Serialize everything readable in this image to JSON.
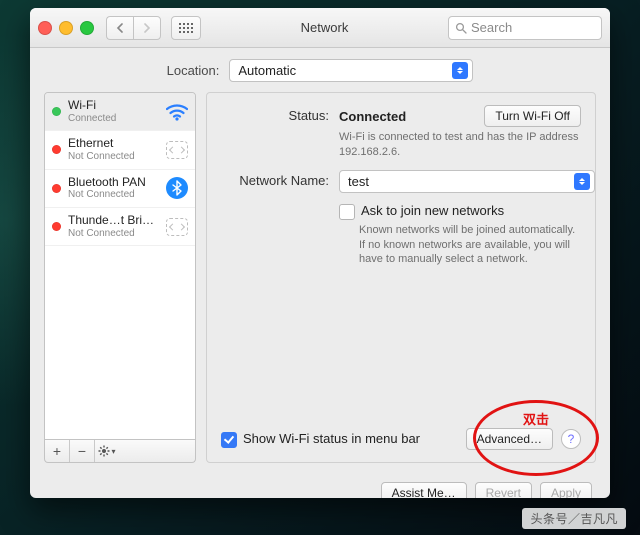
{
  "window": {
    "title": "Network"
  },
  "search": {
    "placeholder": "Search"
  },
  "location": {
    "label": "Location:",
    "value": "Automatic"
  },
  "sidebar": {
    "items": [
      {
        "name": "Wi-Fi",
        "status": "Connected",
        "state": "green",
        "icon": "wifi"
      },
      {
        "name": "Ethernet",
        "status": "Not Connected",
        "state": "red",
        "icon": "plug"
      },
      {
        "name": "Bluetooth PAN",
        "status": "Not Connected",
        "state": "red",
        "icon": "bt"
      },
      {
        "name": "Thunde…t Bridge",
        "status": "Not Connected",
        "state": "red",
        "icon": "plug"
      }
    ],
    "footer": {
      "add": "+",
      "remove": "−",
      "gear": "✻",
      "chev": "▾"
    }
  },
  "detail": {
    "status_label": "Status:",
    "status_value": "Connected",
    "wifi_off_btn": "Turn Wi-Fi Off",
    "status_desc": "Wi-Fi is connected to test and has the IP address 192.168.2.6.",
    "netname_label": "Network Name:",
    "netname_value": "test",
    "ask_join": "Ask to join new networks",
    "ask_join_desc": "Known networks will be joined automatically. If no known networks are available, you will have to manually select a network.",
    "show_status": "Show Wi-Fi status in menu bar",
    "advanced_btn": "Advanced…",
    "help": "?"
  },
  "footer": {
    "assist": "Assist Me…",
    "revert": "Revert",
    "apply": "Apply"
  },
  "annotation": {
    "text": "双击"
  },
  "watermark": "头条号／吉凡凡"
}
